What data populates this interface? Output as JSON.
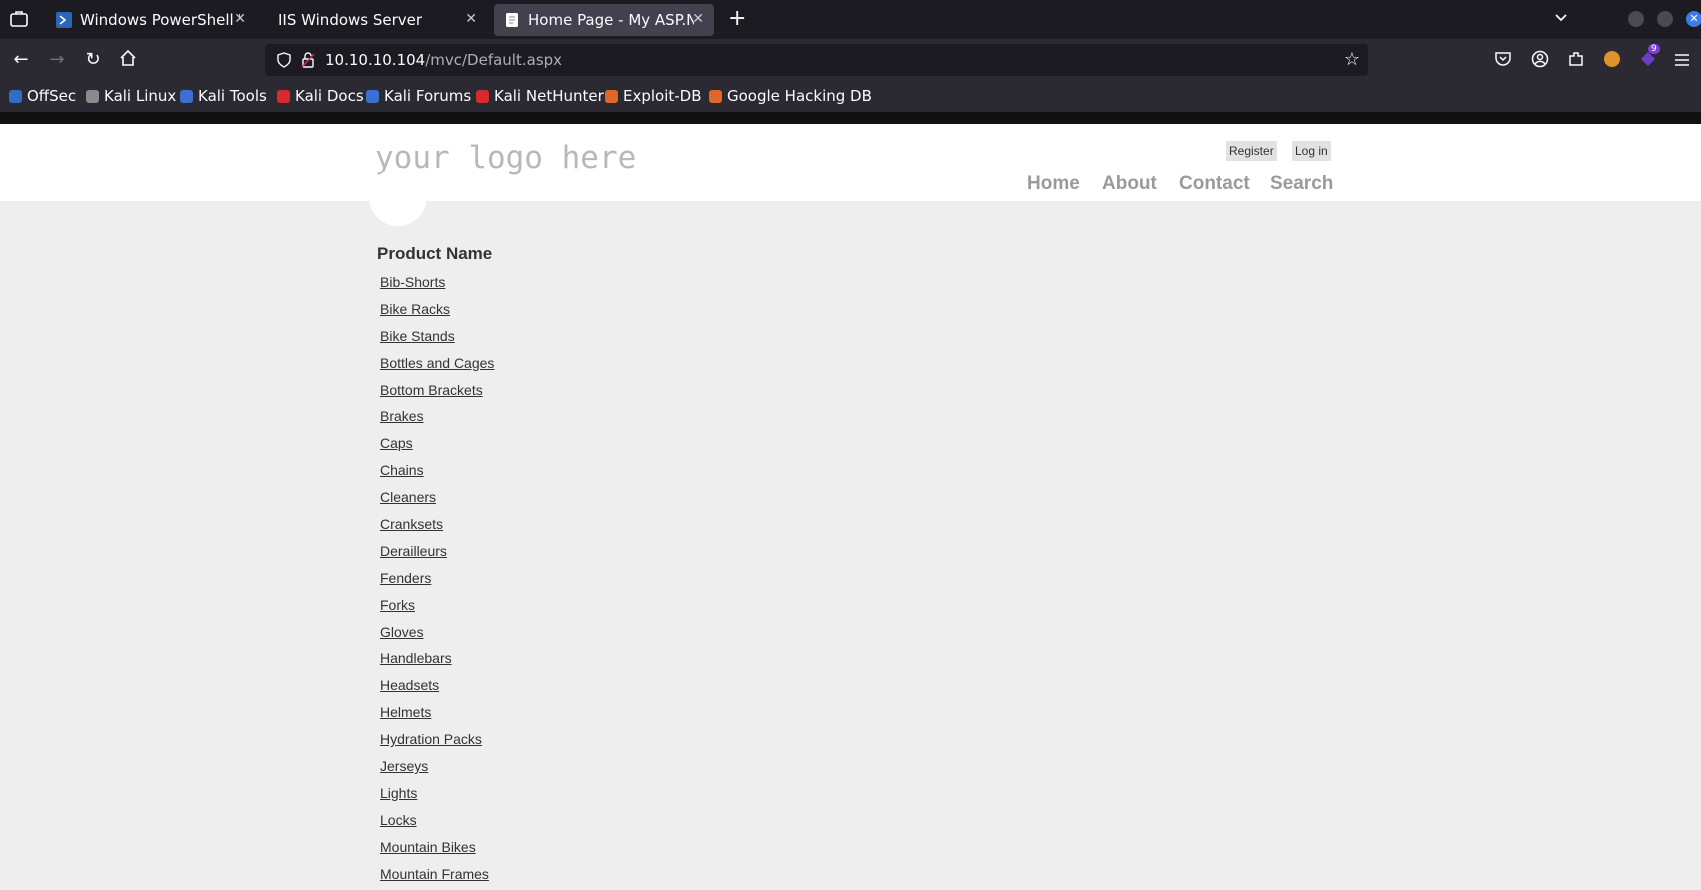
{
  "browser": {
    "tabs": [
      {
        "label": "Windows PowerShell Web Access",
        "icon": "powershell-icon",
        "active": false
      },
      {
        "label": "IIS Windows Server",
        "icon": "",
        "active": false
      },
      {
        "label": "Home Page - My ASP.NET Application",
        "icon": "page-icon",
        "active": true
      }
    ],
    "url": {
      "host": "10.10.10.104",
      "path": "/mvc/Default.aspx"
    },
    "extension_badge": "9",
    "bookmarks": [
      {
        "label": "OffSec",
        "color": "#2f6ec7"
      },
      {
        "label": "Kali Linux",
        "color": "#8a8a8a"
      },
      {
        "label": "Kali Tools",
        "color": "#3b6fd1"
      },
      {
        "label": "Kali Docs",
        "color": "#d62b2b"
      },
      {
        "label": "Kali Forums",
        "color": "#3b6fd1"
      },
      {
        "label": "Kali NetHunter",
        "color": "#d62b2b"
      },
      {
        "label": "Exploit-DB",
        "color": "#e0662a"
      },
      {
        "label": "Google Hacking DB",
        "color": "#e0662a"
      }
    ]
  },
  "site": {
    "logo": "your logo here",
    "register_label": "Register",
    "login_label": "Log in",
    "menu": [
      "Home",
      "About",
      "Contact",
      "Search"
    ]
  },
  "products": {
    "heading": "Product Name",
    "items": [
      "Bib-Shorts",
      "Bike Racks",
      "Bike Stands",
      "Bottles and Cages",
      "Bottom Brackets",
      "Brakes",
      "Caps",
      "Chains",
      "Cleaners",
      "Cranksets",
      "Derailleurs",
      "Fenders",
      "Forks",
      "Gloves",
      "Handlebars",
      "Headsets",
      "Helmets",
      "Hydration Packs",
      "Jerseys",
      "Lights",
      "Locks",
      "Mountain Bikes",
      "Mountain Frames"
    ]
  }
}
